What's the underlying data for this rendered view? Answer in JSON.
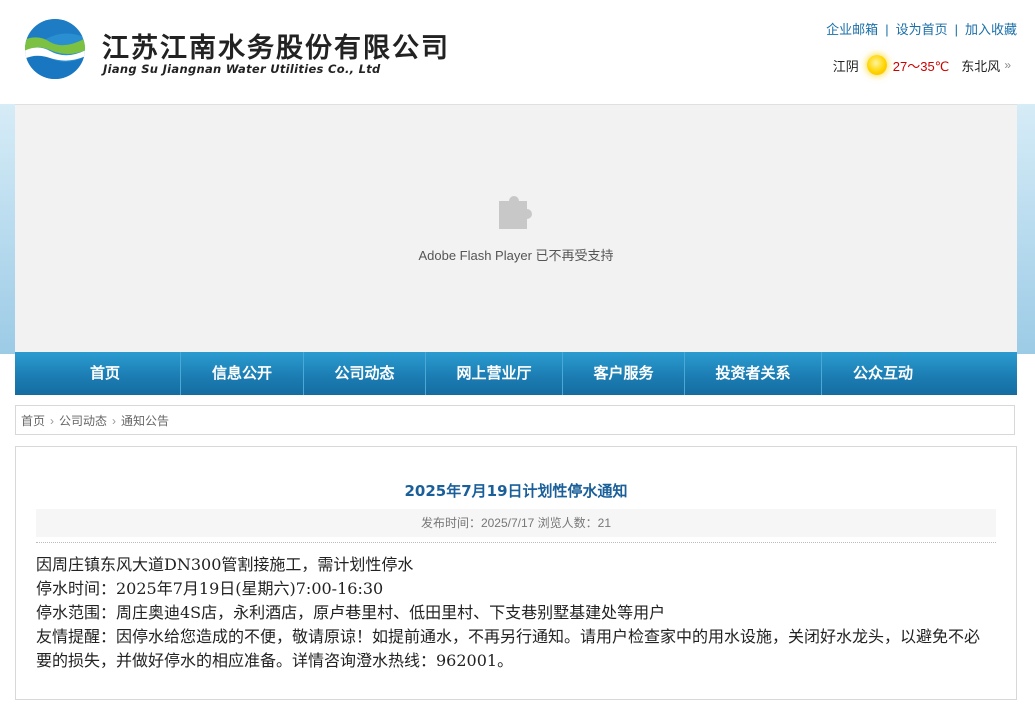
{
  "header": {
    "company_cn": "江苏江南水务股份有限公司",
    "company_en": "Jiang Su Jiangnan Water Utilities Co., Ltd",
    "links": [
      "企业邮箱",
      "设为首页",
      "加入收藏"
    ],
    "weather": {
      "city": "江阴",
      "icon": "sun-icon",
      "temp": "27～35℃",
      "wind": "东北风"
    }
  },
  "banner": {
    "icon": "plugin-icon",
    "message": "Adobe Flash Player 已不再受支持"
  },
  "nav": {
    "items": [
      "首页",
      "信息公开",
      "公司动态",
      "网上营业厅",
      "客户服务",
      "投资者关系",
      "公众互动"
    ]
  },
  "breadcrumb": {
    "items": [
      "首页",
      "公司动态",
      "通知公告"
    ]
  },
  "article": {
    "title": "2025年7月19日计划性停水通知",
    "meta": "发布时间：2025/7/17 浏览人数：21",
    "paragraphs": [
      "因周庄镇东风大道DN300管割接施工，需计划性停水",
      "停水时间：2025年7月19日(星期六)7:00-16:30",
      "停水范围：周庄奥迪4S店，永利酒店，原卢巷里村、低田里村、下支巷别墅基建处等用户",
      "友情提醒：因停水给您造成的不便，敬请原谅！如提前通水，不再另行通知。请用户检查家中的用水设施，关闭好水龙头，以避免不必要的损失，并做好停水的相应准备。详情咨询澄水热线：962001。"
    ]
  },
  "colors": {
    "nav_blue": "#1c7eb4",
    "link_blue": "#1a6fa8",
    "title_blue": "#1a5f99",
    "temp_red": "#cc0000"
  }
}
